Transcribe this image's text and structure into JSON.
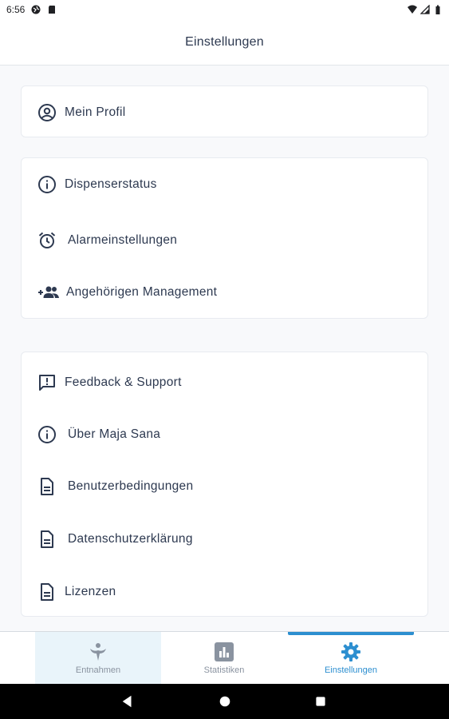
{
  "status_bar": {
    "time": "6:56"
  },
  "header": {
    "title": "Einstellungen"
  },
  "cards": [
    {
      "items": [
        {
          "label": "Mein Profil",
          "icon": "account-circle-icon"
        }
      ]
    },
    {
      "items": [
        {
          "label": "Dispenserstatus",
          "icon": "info-icon"
        },
        {
          "label": "Alarmeinstellungen",
          "icon": "alarm-clock-icon"
        },
        {
          "label": "Angehörigen Management",
          "icon": "group-add-icon"
        }
      ]
    },
    {
      "items": [
        {
          "label": "Feedback & Support",
          "icon": "feedback-icon"
        },
        {
          "label": "Über Maja Sana",
          "icon": "info-icon"
        },
        {
          "label": "Benutzerbedingungen",
          "icon": "document-icon"
        },
        {
          "label": "Datenschutzerklärung",
          "icon": "document-icon"
        },
        {
          "label": "Lizenzen",
          "icon": "document-icon"
        }
      ]
    }
  ],
  "bottom_nav": {
    "tabs": [
      {
        "label": "Entnahmen",
        "icon": "person-leaf-icon"
      },
      {
        "label": "Statistiken",
        "icon": "bar-chart-icon"
      },
      {
        "label": "Einstellungen",
        "icon": "gear-icon"
      }
    ],
    "active_tab": "Einstellungen"
  },
  "colors": {
    "accent": "#2d8fd0",
    "text": "#2d3950",
    "inactive": "#8a93a0"
  }
}
